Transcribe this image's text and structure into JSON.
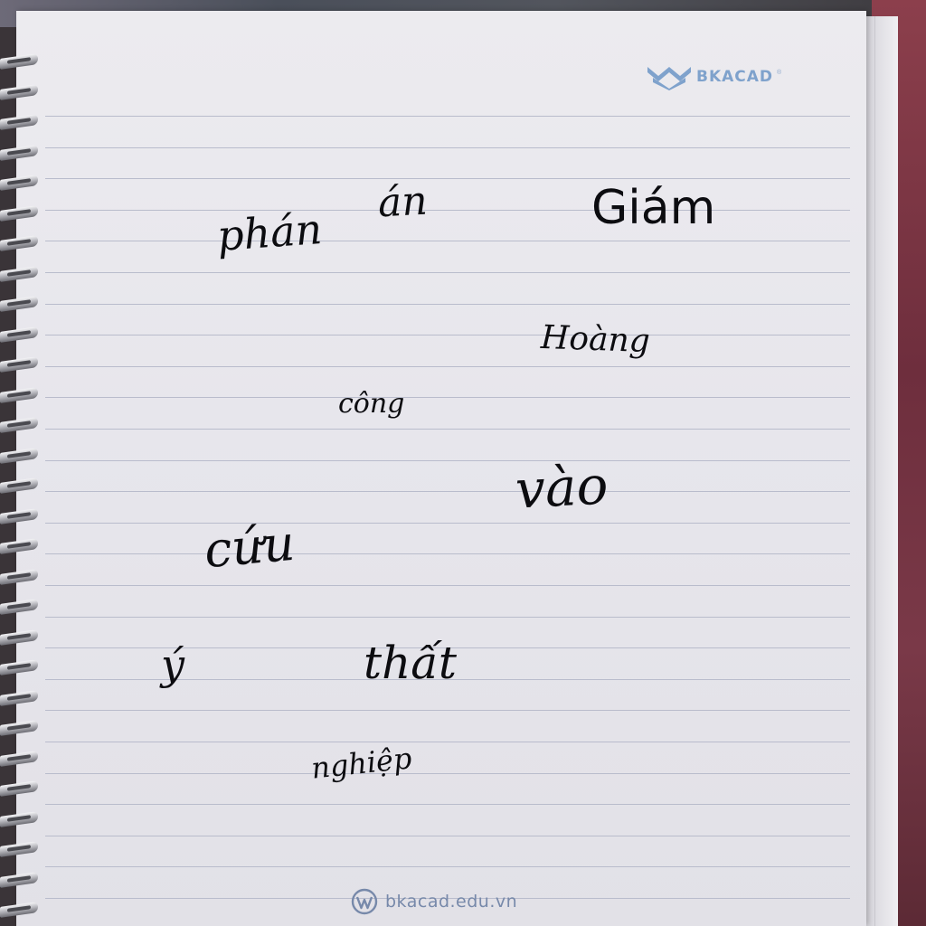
{
  "notebook": {
    "brand": {
      "name": "BKACAD",
      "registered": "®"
    },
    "footer": {
      "url": "bkacad.edu.vn"
    },
    "colors": {
      "brand_blue": "#7fa2cc",
      "rule_line": "#b9bccc",
      "paper": "#e8e7ec",
      "ink": "#0c0c10"
    }
  },
  "handwriting": {
    "phan": "phán",
    "an": "án",
    "giam": "Giám",
    "hoang": "Hoàng",
    "cong": "công",
    "vao": "vào",
    "cuu": "cứu",
    "y": "ý",
    "that": "thất",
    "nghiep": "nghiệp"
  }
}
